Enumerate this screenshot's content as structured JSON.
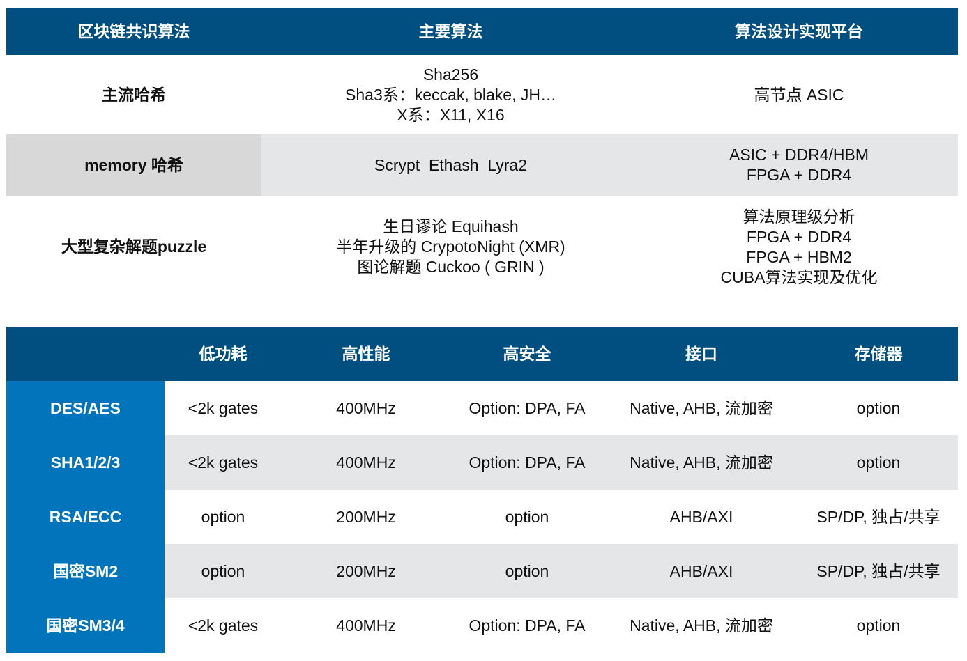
{
  "consensus_table": {
    "headers": [
      "区块链共识算法",
      "主要算法",
      "算法设计实现平台"
    ],
    "rows": [
      {
        "name": "主流哈希",
        "algorithms": [
          "Sha256",
          "Sha3系：keccak, blake, JH…",
          "X系：X11, X16"
        ],
        "platforms": [
          "高节点 ASIC"
        ]
      },
      {
        "name": "memory 哈希",
        "algorithms": [
          "Scrypt  Ethash  Lyra2"
        ],
        "platforms": [
          "ASIC + DDR4/HBM",
          "FPGA + DDR4"
        ]
      },
      {
        "name": "大型复杂解题puzzle",
        "algorithms": [
          "生日谬论 Equihash",
          "半年升级的 CrypotoNight (XMR)",
          "图论解题 Cuckoo ( GRIN )"
        ],
        "platforms": [
          "算法原理级分析",
          "FPGA + DDR4",
          "FPGA + HBM2",
          "CUBA算法实现及优化"
        ]
      }
    ]
  },
  "ip_table": {
    "headers": [
      "",
      "低功耗",
      "高性能",
      "高安全",
      "接口",
      "存储器"
    ],
    "rows": [
      [
        "DES/AES",
        "<2k gates",
        "400MHz",
        "Option: DPA, FA",
        "Native, AHB, 流加密",
        "option"
      ],
      [
        "SHA1/2/3",
        "<2k gates",
        "400MHz",
        "Option: DPA, FA",
        "Native, AHB, 流加密",
        "option"
      ],
      [
        "RSA/ECC",
        "option",
        "200MHz",
        "option",
        "AHB/AXI",
        "SP/DP, 独占/共享"
      ],
      [
        "国密SM2",
        "option",
        "200MHz",
        "option",
        "AHB/AXI",
        "SP/DP, 独占/共享"
      ],
      [
        "国密SM3/4",
        "<2k gates",
        "400MHz",
        "Option: DPA, FA",
        "Native, AHB, 流加密",
        "option"
      ]
    ]
  },
  "colors": {
    "header_bg": "#004f81",
    "row_label_bg": "#0174bb",
    "alt_row_bg": "#e5e6e8"
  }
}
